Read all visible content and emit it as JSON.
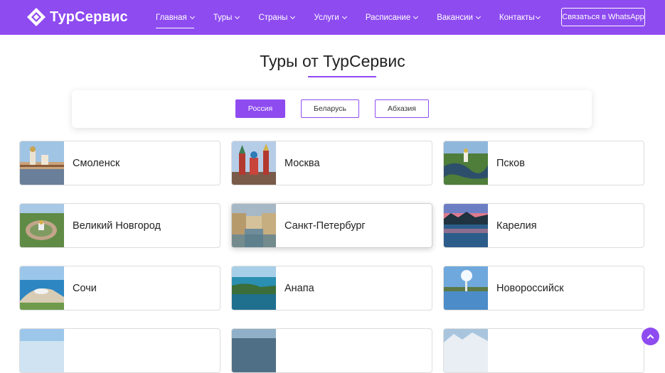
{
  "brand": {
    "name": "ТурСервис"
  },
  "nav": {
    "items": [
      {
        "label": "Главная",
        "active": true
      },
      {
        "label": "Туры"
      },
      {
        "label": "Страны"
      },
      {
        "label": "Услуги"
      },
      {
        "label": "Расписание"
      },
      {
        "label": "Вакансии"
      },
      {
        "label": "Контакты"
      }
    ],
    "whatsapp_label": "Связаться в WhatsApp"
  },
  "page": {
    "title": "Туры от ТурСервис"
  },
  "filters": [
    {
      "label": "Россия",
      "active": true
    },
    {
      "label": "Беларусь"
    },
    {
      "label": "Абхазия"
    }
  ],
  "destinations": [
    {
      "name": "Смоленск",
      "icon": "smolensk-photo"
    },
    {
      "name": "Москва",
      "icon": "moscow-photo"
    },
    {
      "name": "Псков",
      "icon": "pskov-photo"
    },
    {
      "name": "Великий Новгород",
      "icon": "veliky-novgorod-photo"
    },
    {
      "name": "Санкт-Петербург",
      "icon": "saint-petersburg-photo"
    },
    {
      "name": "Карелия",
      "icon": "karelia-photo"
    },
    {
      "name": "Сочи",
      "icon": "sochi-photo"
    },
    {
      "name": "Анапа",
      "icon": "anapa-photo"
    },
    {
      "name": "Новороссийск",
      "icon": "novorossiysk-photo"
    }
  ],
  "colors": {
    "accent": "#8e4bf0"
  }
}
